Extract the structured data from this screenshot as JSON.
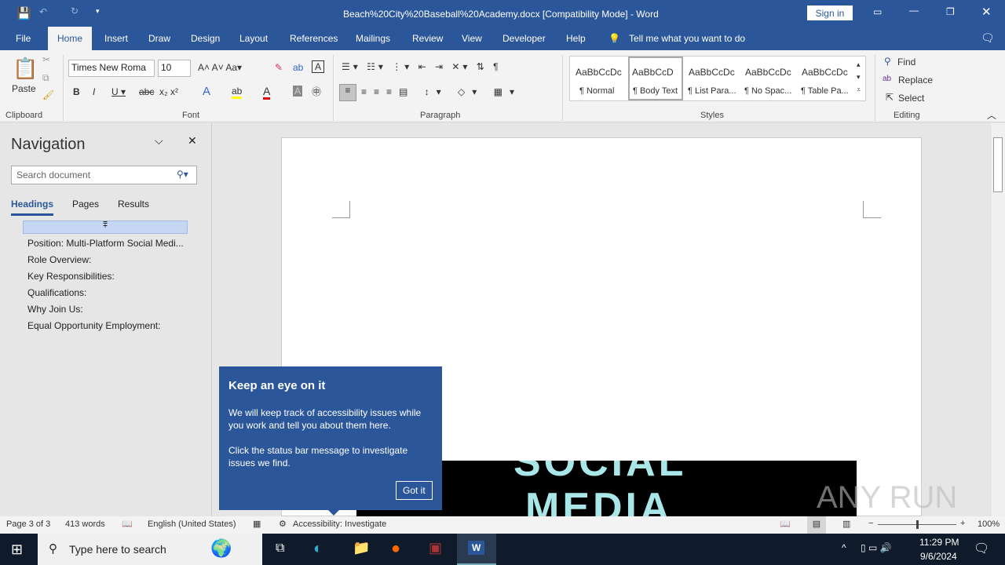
{
  "title": {
    "doc": "Beach%20City%20Baseball%20Academy.docx [Compatibility Mode]  -  Word",
    "sign_in": "Sign in"
  },
  "tabs": [
    "File",
    "Home",
    "Insert",
    "Draw",
    "Design",
    "Layout",
    "References",
    "Mailings",
    "Review",
    "View",
    "Developer",
    "Help"
  ],
  "tell_me": "Tell me what you want to do",
  "ribbon": {
    "paste": "Paste",
    "font_name": "Times New Roma",
    "font_size": "10",
    "groups": [
      "Clipboard",
      "Font",
      "Paragraph",
      "Styles",
      "Editing"
    ],
    "styles": [
      {
        "preview": "AaBbCcDc",
        "name": "¶ Normal"
      },
      {
        "preview": "AaBbCcD",
        "name": "¶ Body Text"
      },
      {
        "preview": "AaBbCcDc",
        "name": "¶ List Para..."
      },
      {
        "preview": "AaBbCcDc",
        "name": "¶ No Spac..."
      },
      {
        "preview": "AaBbCcDc",
        "name": "¶ Table Pa..."
      }
    ],
    "find": "Find",
    "replace": "Replace",
    "select": "Select"
  },
  "nav": {
    "title": "Navigation",
    "search_placeholder": "Search document",
    "tabs": [
      "Headings",
      "Pages",
      "Results"
    ],
    "headings": [
      "Position: Multi-Platform Social Medi...",
      "Role Overview:",
      "Key Responsibilities:",
      "Qualifications:",
      "Why Join Us:",
      "Equal Opportunity Employment:"
    ]
  },
  "doc": {
    "image_text_1": "SOCIAL",
    "image_text_2": "MEDIA"
  },
  "tip": {
    "title": "Keep an eye on it",
    "p1": "We will keep track of accessibility issues while you work and tell you about them here.",
    "p2": "Click the status bar message to investigate issues we find.",
    "button": "Got it"
  },
  "status": {
    "page": "Page 3 of 3",
    "words": "413 words",
    "language": "English (United States)",
    "accessibility": "Accessibility: Investigate",
    "zoom": "100%"
  },
  "taskbar": {
    "search": "Type here to search",
    "time": "11:29 PM",
    "date": "9/6/2024"
  },
  "watermark": "ANY RUN"
}
